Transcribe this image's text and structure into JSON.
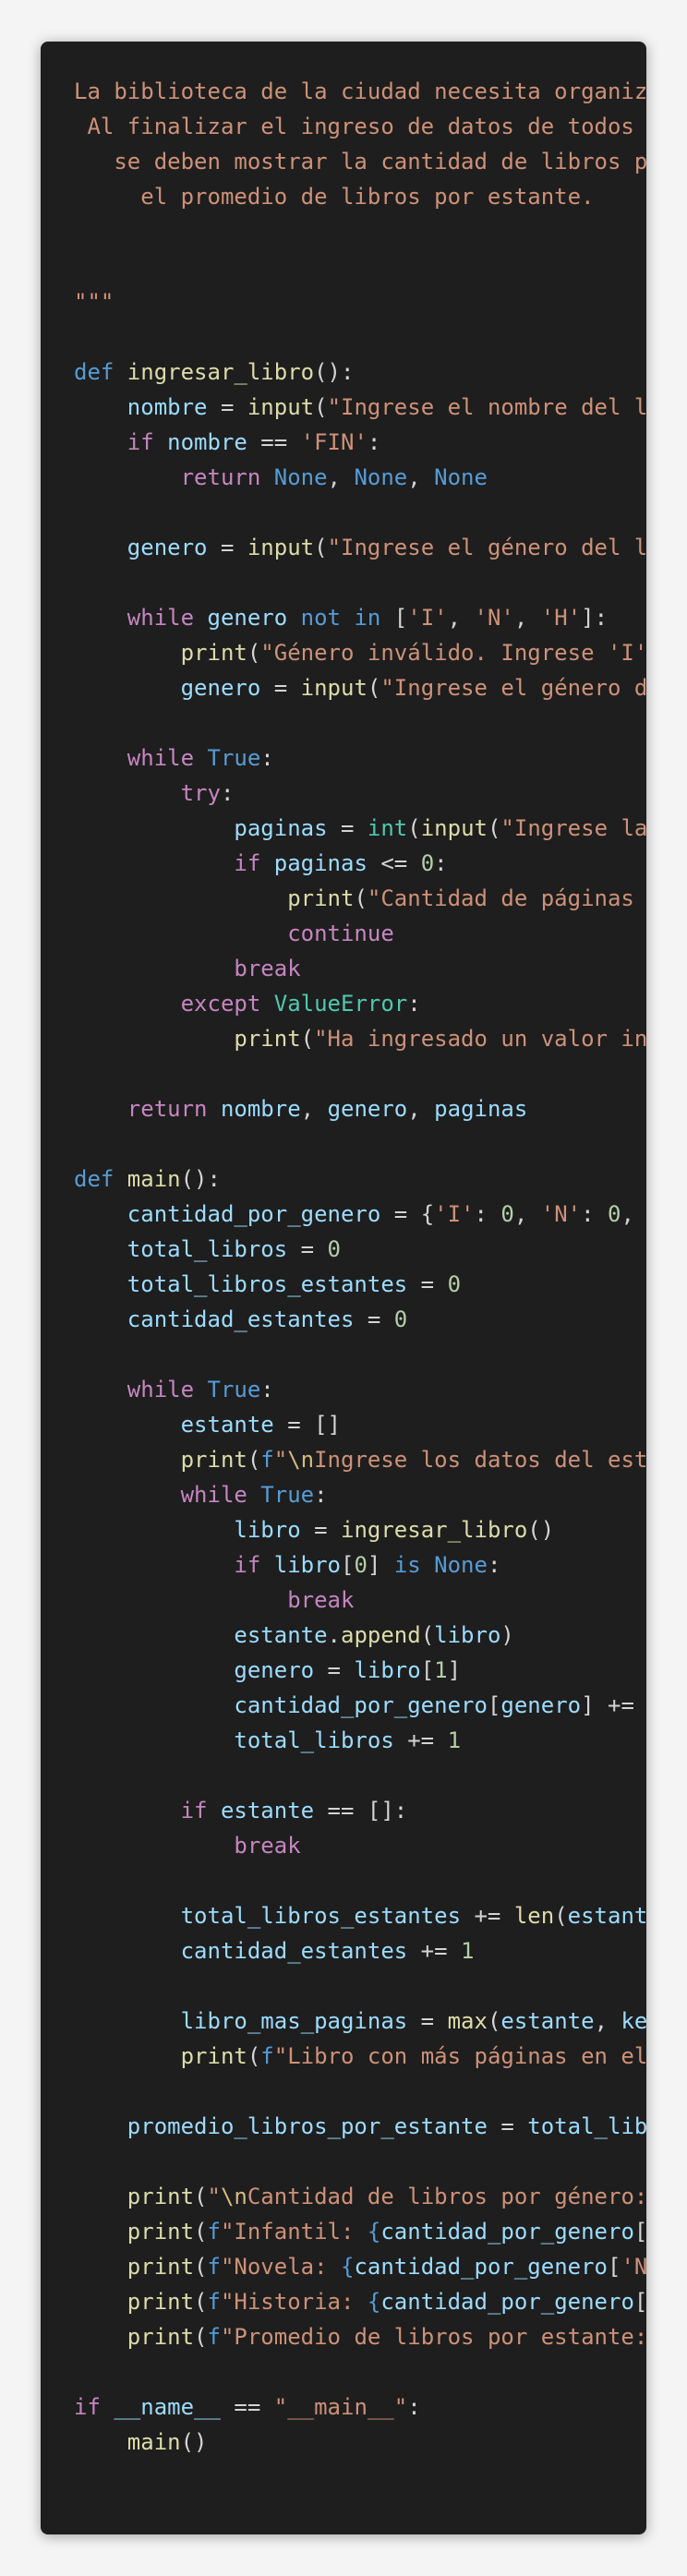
{
  "theme": {
    "background": "#1e1e1e",
    "page_background": "#f4f4f4",
    "colors": {
      "str": "#ce9178",
      "kw": "#569cd6",
      "ctrl": "#c586c0",
      "fn": "#dcdcaa",
      "var": "#9cdcfe",
      "num": "#b5cea8",
      "cls": "#4ec9b0",
      "plain": "#d4d4d4",
      "esc": "#d7ba7d"
    }
  },
  "code_lines": [
    [
      [
        "str",
        "La biblioteca de la ciudad necesita organiz"
      ]
    ],
    [
      [
        "str",
        " Al finalizar el ingreso de datos de todos "
      ]
    ],
    [
      [
        "str",
        "   se deben mostrar la cantidad de libros p"
      ]
    ],
    [
      [
        "str",
        "     el promedio de libros por estante."
      ]
    ],
    [],
    [],
    [
      [
        "str",
        "\"\"\""
      ]
    ],
    [],
    [
      [
        "kw",
        "def "
      ],
      [
        "fn",
        "ingresar_libro"
      ],
      [
        "plain",
        "():"
      ]
    ],
    [
      [
        "plain",
        "    "
      ],
      [
        "var",
        "nombre"
      ],
      [
        "plain",
        " = "
      ],
      [
        "fn",
        "input"
      ],
      [
        "plain",
        "("
      ],
      [
        "str",
        "\"Ingrese el nombre del l"
      ]
    ],
    [
      [
        "plain",
        "    "
      ],
      [
        "ctrl",
        "if "
      ],
      [
        "var",
        "nombre"
      ],
      [
        "plain",
        " == "
      ],
      [
        "str",
        "'FIN'"
      ],
      [
        "plain",
        ":"
      ]
    ],
    [
      [
        "plain",
        "        "
      ],
      [
        "ctrl",
        "return "
      ],
      [
        "kw",
        "None"
      ],
      [
        "plain",
        ", "
      ],
      [
        "kw",
        "None"
      ],
      [
        "plain",
        ", "
      ],
      [
        "kw",
        "None"
      ]
    ],
    [],
    [
      [
        "plain",
        "    "
      ],
      [
        "var",
        "genero"
      ],
      [
        "plain",
        " = "
      ],
      [
        "fn",
        "input"
      ],
      [
        "plain",
        "("
      ],
      [
        "str",
        "\"Ingrese el género del l"
      ]
    ],
    [],
    [
      [
        "plain",
        "    "
      ],
      [
        "ctrl",
        "while "
      ],
      [
        "var",
        "genero"
      ],
      [
        "plain",
        " "
      ],
      [
        "kw",
        "not in"
      ],
      [
        "plain",
        " ["
      ],
      [
        "str",
        "'I'"
      ],
      [
        "plain",
        ", "
      ],
      [
        "str",
        "'N'"
      ],
      [
        "plain",
        ", "
      ],
      [
        "str",
        "'H'"
      ],
      [
        "plain",
        "]:"
      ]
    ],
    [
      [
        "plain",
        "        "
      ],
      [
        "fn",
        "print"
      ],
      [
        "plain",
        "("
      ],
      [
        "str",
        "\"Género inválido. Ingrese 'I'"
      ]
    ],
    [
      [
        "plain",
        "        "
      ],
      [
        "var",
        "genero"
      ],
      [
        "plain",
        " = "
      ],
      [
        "fn",
        "input"
      ],
      [
        "plain",
        "("
      ],
      [
        "str",
        "\"Ingrese el género d"
      ]
    ],
    [],
    [
      [
        "plain",
        "    "
      ],
      [
        "ctrl",
        "while "
      ],
      [
        "kw",
        "True"
      ],
      [
        "plain",
        ":"
      ]
    ],
    [
      [
        "plain",
        "        "
      ],
      [
        "ctrl",
        "try"
      ],
      [
        "plain",
        ":"
      ]
    ],
    [
      [
        "plain",
        "            "
      ],
      [
        "var",
        "paginas"
      ],
      [
        "plain",
        " = "
      ],
      [
        "cls",
        "int"
      ],
      [
        "plain",
        "("
      ],
      [
        "fn",
        "input"
      ],
      [
        "plain",
        "("
      ],
      [
        "str",
        "\"Ingrese la"
      ]
    ],
    [
      [
        "plain",
        "            "
      ],
      [
        "ctrl",
        "if "
      ],
      [
        "var",
        "paginas"
      ],
      [
        "plain",
        " <= "
      ],
      [
        "num",
        "0"
      ],
      [
        "plain",
        ":"
      ]
    ],
    [
      [
        "plain",
        "                "
      ],
      [
        "fn",
        "print"
      ],
      [
        "plain",
        "("
      ],
      [
        "str",
        "\"Cantidad de páginas "
      ]
    ],
    [
      [
        "plain",
        "                "
      ],
      [
        "ctrl",
        "continue"
      ]
    ],
    [
      [
        "plain",
        "            "
      ],
      [
        "ctrl",
        "break"
      ]
    ],
    [
      [
        "plain",
        "        "
      ],
      [
        "ctrl",
        "except "
      ],
      [
        "cls",
        "ValueError"
      ],
      [
        "plain",
        ":"
      ]
    ],
    [
      [
        "plain",
        "            "
      ],
      [
        "fn",
        "print"
      ],
      [
        "plain",
        "("
      ],
      [
        "str",
        "\"Ha ingresado un valor in"
      ]
    ],
    [],
    [
      [
        "plain",
        "    "
      ],
      [
        "ctrl",
        "return "
      ],
      [
        "var",
        "nombre"
      ],
      [
        "plain",
        ", "
      ],
      [
        "var",
        "genero"
      ],
      [
        "plain",
        ", "
      ],
      [
        "var",
        "paginas"
      ]
    ],
    [],
    [
      [
        "kw",
        "def "
      ],
      [
        "fn",
        "main"
      ],
      [
        "plain",
        "():"
      ]
    ],
    [
      [
        "plain",
        "    "
      ],
      [
        "var",
        "cantidad_por_genero"
      ],
      [
        "plain",
        " = {"
      ],
      [
        "str",
        "'I'"
      ],
      [
        "plain",
        ": "
      ],
      [
        "num",
        "0"
      ],
      [
        "plain",
        ", "
      ],
      [
        "str",
        "'N'"
      ],
      [
        "plain",
        ": "
      ],
      [
        "num",
        "0"
      ],
      [
        "plain",
        ","
      ]
    ],
    [
      [
        "plain",
        "    "
      ],
      [
        "var",
        "total_libros"
      ],
      [
        "plain",
        " = "
      ],
      [
        "num",
        "0"
      ]
    ],
    [
      [
        "plain",
        "    "
      ],
      [
        "var",
        "total_libros_estantes"
      ],
      [
        "plain",
        " = "
      ],
      [
        "num",
        "0"
      ]
    ],
    [
      [
        "plain",
        "    "
      ],
      [
        "var",
        "cantidad_estantes"
      ],
      [
        "plain",
        " = "
      ],
      [
        "num",
        "0"
      ]
    ],
    [],
    [
      [
        "plain",
        "    "
      ],
      [
        "ctrl",
        "while "
      ],
      [
        "kw",
        "True"
      ],
      [
        "plain",
        ":"
      ]
    ],
    [
      [
        "plain",
        "        "
      ],
      [
        "var",
        "estante"
      ],
      [
        "plain",
        " = []"
      ]
    ],
    [
      [
        "plain",
        "        "
      ],
      [
        "fn",
        "print"
      ],
      [
        "plain",
        "("
      ],
      [
        "kw",
        "f"
      ],
      [
        "str",
        "\""
      ],
      [
        "esc",
        "\\n"
      ],
      [
        "str",
        "Ingrese los datos del est"
      ]
    ],
    [
      [
        "plain",
        "        "
      ],
      [
        "ctrl",
        "while "
      ],
      [
        "kw",
        "True"
      ],
      [
        "plain",
        ":"
      ]
    ],
    [
      [
        "plain",
        "            "
      ],
      [
        "var",
        "libro"
      ],
      [
        "plain",
        " = "
      ],
      [
        "fn",
        "ingresar_libro"
      ],
      [
        "plain",
        "()"
      ]
    ],
    [
      [
        "plain",
        "            "
      ],
      [
        "ctrl",
        "if "
      ],
      [
        "var",
        "libro"
      ],
      [
        "plain",
        "["
      ],
      [
        "num",
        "0"
      ],
      [
        "plain",
        "] "
      ],
      [
        "kw",
        "is None"
      ],
      [
        "plain",
        ":"
      ]
    ],
    [
      [
        "plain",
        "                "
      ],
      [
        "ctrl",
        "break"
      ]
    ],
    [
      [
        "plain",
        "            "
      ],
      [
        "var",
        "estante"
      ],
      [
        "plain",
        "."
      ],
      [
        "fn",
        "append"
      ],
      [
        "plain",
        "("
      ],
      [
        "var",
        "libro"
      ],
      [
        "plain",
        ")"
      ]
    ],
    [
      [
        "plain",
        "            "
      ],
      [
        "var",
        "genero"
      ],
      [
        "plain",
        " = "
      ],
      [
        "var",
        "libro"
      ],
      [
        "plain",
        "["
      ],
      [
        "num",
        "1"
      ],
      [
        "plain",
        "]"
      ]
    ],
    [
      [
        "plain",
        "            "
      ],
      [
        "var",
        "cantidad_por_genero"
      ],
      [
        "plain",
        "["
      ],
      [
        "var",
        "genero"
      ],
      [
        "plain",
        "] +="
      ]
    ],
    [
      [
        "plain",
        "            "
      ],
      [
        "var",
        "total_libros"
      ],
      [
        "plain",
        " += "
      ],
      [
        "num",
        "1"
      ]
    ],
    [],
    [
      [
        "plain",
        "        "
      ],
      [
        "ctrl",
        "if "
      ],
      [
        "var",
        "estante"
      ],
      [
        "plain",
        " == []:"
      ]
    ],
    [
      [
        "plain",
        "            "
      ],
      [
        "ctrl",
        "break"
      ]
    ],
    [],
    [
      [
        "plain",
        "        "
      ],
      [
        "var",
        "total_libros_estantes"
      ],
      [
        "plain",
        " += "
      ],
      [
        "fn",
        "len"
      ],
      [
        "plain",
        "("
      ],
      [
        "var",
        "estant"
      ]
    ],
    [
      [
        "plain",
        "        "
      ],
      [
        "var",
        "cantidad_estantes"
      ],
      [
        "plain",
        " += "
      ],
      [
        "num",
        "1"
      ]
    ],
    [],
    [
      [
        "plain",
        "        "
      ],
      [
        "var",
        "libro_mas_paginas"
      ],
      [
        "plain",
        " = "
      ],
      [
        "fn",
        "max"
      ],
      [
        "plain",
        "("
      ],
      [
        "var",
        "estante"
      ],
      [
        "plain",
        ", "
      ],
      [
        "var",
        "ke"
      ]
    ],
    [
      [
        "plain",
        "        "
      ],
      [
        "fn",
        "print"
      ],
      [
        "plain",
        "("
      ],
      [
        "kw",
        "f"
      ],
      [
        "str",
        "\"Libro con más páginas en el"
      ]
    ],
    [],
    [
      [
        "plain",
        "    "
      ],
      [
        "var",
        "promedio_libros_por_estante"
      ],
      [
        "plain",
        " = "
      ],
      [
        "var",
        "total_lib"
      ]
    ],
    [],
    [
      [
        "plain",
        "    "
      ],
      [
        "fn",
        "print"
      ],
      [
        "plain",
        "("
      ],
      [
        "str",
        "\""
      ],
      [
        "esc",
        "\\n"
      ],
      [
        "str",
        "Cantidad de libros por género:"
      ]
    ],
    [
      [
        "plain",
        "    "
      ],
      [
        "fn",
        "print"
      ],
      [
        "plain",
        "("
      ],
      [
        "kw",
        "f"
      ],
      [
        "str",
        "\"Infantil: "
      ],
      [
        "kw",
        "{"
      ],
      [
        "var",
        "cantidad_por_genero"
      ],
      [
        "plain",
        "["
      ]
    ],
    [
      [
        "plain",
        "    "
      ],
      [
        "fn",
        "print"
      ],
      [
        "plain",
        "("
      ],
      [
        "kw",
        "f"
      ],
      [
        "str",
        "\"Novela: "
      ],
      [
        "kw",
        "{"
      ],
      [
        "var",
        "cantidad_por_genero"
      ],
      [
        "plain",
        "["
      ],
      [
        "str",
        "'N"
      ]
    ],
    [
      [
        "plain",
        "    "
      ],
      [
        "fn",
        "print"
      ],
      [
        "plain",
        "("
      ],
      [
        "kw",
        "f"
      ],
      [
        "str",
        "\"Historia: "
      ],
      [
        "kw",
        "{"
      ],
      [
        "var",
        "cantidad_por_genero"
      ],
      [
        "plain",
        "["
      ]
    ],
    [
      [
        "plain",
        "    "
      ],
      [
        "fn",
        "print"
      ],
      [
        "plain",
        "("
      ],
      [
        "kw",
        "f"
      ],
      [
        "str",
        "\"Promedio de libros por estante:"
      ]
    ],
    [],
    [
      [
        "ctrl",
        "if "
      ],
      [
        "var",
        "__name__"
      ],
      [
        "plain",
        " == "
      ],
      [
        "str",
        "\"__main__\""
      ],
      [
        "plain",
        ":"
      ]
    ],
    [
      [
        "plain",
        "    "
      ],
      [
        "fn",
        "main"
      ],
      [
        "plain",
        "()"
      ]
    ]
  ]
}
